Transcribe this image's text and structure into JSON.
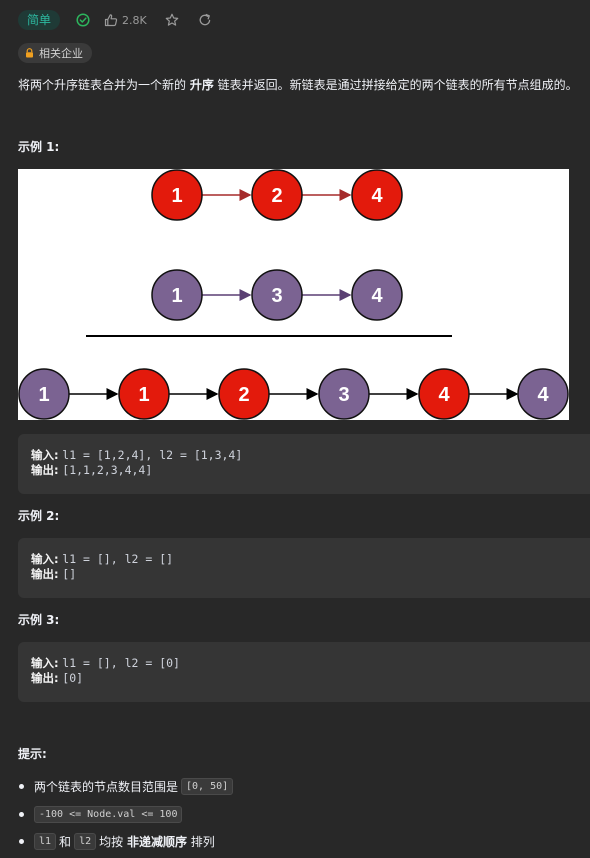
{
  "header": {
    "difficulty": "简单",
    "like_count": "2.8K",
    "colors": {
      "difficulty_text": "#2db8a0",
      "difficulty_bg": "#1f3a36",
      "solved_check": "#2db55d"
    },
    "icons": [
      "check-circle-icon",
      "thumbs-up-icon",
      "star-icon",
      "share-icon"
    ]
  },
  "company_tag": {
    "label": "相关企业",
    "icon": "lock-icon",
    "icon_color": "#f0a020"
  },
  "description": {
    "before": "将两个升序链表合并为一个新的 ",
    "emph": "升序",
    "after": " 链表并返回。新链表是通过拼接给定的两个链表的所有节点组成的。"
  },
  "examples": [
    {
      "title": "示例 1:",
      "input_label": "输入:",
      "input_value": "l1 = [1,2,4], l2 = [1,3,4]",
      "output_label": "输出:",
      "output_value": "[1,1,2,3,4,4]"
    },
    {
      "title": "示例 2:",
      "input_label": "输入:",
      "input_value": "l1 = [], l2 = []",
      "output_label": "输出:",
      "output_value": "[]"
    },
    {
      "title": "示例 3:",
      "input_label": "输入:",
      "input_value": "l1 = [], l2 = [0]",
      "output_label": "输出:",
      "output_value": "[0]"
    }
  ],
  "diagram": {
    "list1": [
      "1",
      "2",
      "4"
    ],
    "list2": [
      "1",
      "3",
      "4"
    ],
    "merged": [
      "1",
      "1",
      "2",
      "3",
      "4",
      "4"
    ],
    "colors": {
      "red": "#e31a0c",
      "purple": "#7b6392",
      "arrow1": "#a52a2a",
      "arrow2": "#5a3f73",
      "arrow3": "#000000"
    }
  },
  "hints": {
    "title": "提示:",
    "item1_text": "两个链表的节点数目范围是",
    "item1_code": "[0, 50]",
    "item2_code": "-100 <= Node.val <= 100",
    "item3_code_a": "l1",
    "item3_and": "和",
    "item3_code_b": "l2",
    "item3_mid": "均按",
    "item3_emph": "非递减顺序",
    "item3_end": "排列"
  }
}
